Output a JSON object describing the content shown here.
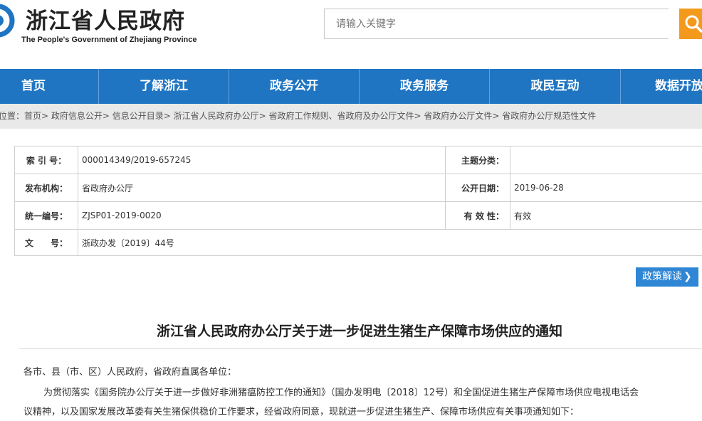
{
  "header": {
    "title": "浙江省人民政府",
    "subtitle": "The People's Government of Zhejiang Province",
    "search_placeholder": "请输入关键字"
  },
  "nav": {
    "items": [
      "首页",
      "了解浙江",
      "政务公开",
      "政务服务",
      "政民互动",
      "数据开放"
    ]
  },
  "breadcrumb": "位置：首页> 政府信息公开> 信息公开目录> 浙江省人民政府办公厅> 省政府工作规则、省政府及办公厅文件> 省政府办公厅文件> 省政府办公厅规范性文件",
  "meta": {
    "index_label": "索 引 号：",
    "index_value": "000014349/2019-657245",
    "topic_label": "主题分类：",
    "topic_value": "",
    "publisher_label": "发布机构：",
    "publisher_value": "省政府办公厅",
    "date_label": "公开日期：",
    "date_value": "2019-06-28",
    "code_label": "统一编号：",
    "code_value": "ZJSP01-2019-0020",
    "validity_label": "有 效 性：",
    "validity_value": "有效",
    "docno_label": "文　　号：",
    "docno_value": "浙政办发〔2019〕44号"
  },
  "interpretation_button": "政策解读",
  "document": {
    "title": "浙江省人民政府办公厅关于进一步促进生猪生产保障市场供应的通知",
    "greeting": "各市、县（市、区）人民政府，省政府直属各单位：",
    "line1": "为贯彻落实《国务院办公厅关于进一步做好非洲猪瘟防控工作的通知》（国办发明电〔2018〕12号）和全国促进生猪生产保障市场供应电视电话会",
    "line2": "议精神，以及国家发展改革委有关生猪保供稳价工作要求，经省政府同意，现就进一步促进生猪生产、保障市场供应有关事项通知如下："
  },
  "colors": {
    "nav_bg": "#1f75c2",
    "search_button": "#f39a1c",
    "button_blue": "#2e86d4",
    "breadcrumb_bg": "#e9e9e9"
  }
}
